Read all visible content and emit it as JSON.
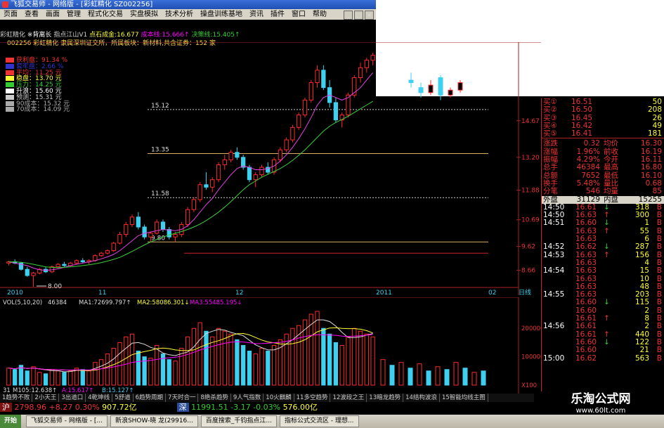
{
  "window": {
    "title": "飞狐交易师 - 网络版 - [彩虹精化 SZ002256]"
  },
  "menu": [
    "页面",
    "查看",
    "画面",
    "管理",
    "程式化交易",
    "实盘模拟",
    "技术分析",
    "操盘训练基地",
    "资讯",
    "插件",
    "窗口",
    "帮助"
  ],
  "win_buttons": [
    "_",
    "□",
    "×"
  ],
  "info": {
    "line1_parts": [
      "彩虹精化",
      "※背离长",
      "指点江山V1",
      "点石成金:16.677",
      "成本线:15.666↑",
      "决策线:15.405↑"
    ],
    "line2": "002256 彩虹精化 隶属深圳证交所，所属板块：新材料,共含证券：152 家"
  },
  "legend": [
    {
      "label": "获利盘：91.34 %",
      "color": "#e33"
    },
    {
      "label": "套牢盘：2.66 %",
      "color": "#33c"
    },
    {
      "label": "平均：11.25 元",
      "color": "#e33"
    },
    {
      "label": "稳盘：13.70 元",
      "color": "#ff3"
    },
    {
      "label": "压力：14.25 元",
      "color": "#3c3"
    },
    {
      "label": "升浪：15.60 元",
      "color": "#fff"
    },
    {
      "label": "预测：15.31 元",
      "color": "#ccc"
    },
    {
      "label": "90成本：15.32 元",
      "color": "#aaa"
    },
    {
      "label": "70成本：14.09 元",
      "color": "#aaa"
    }
  ],
  "price_annotations": [
    "15.12",
    "13.35",
    "11.58",
    "9.80",
    "8.00"
  ],
  "price_axis": [
    "14.67",
    "13.20",
    "11.88",
    "10.69",
    "9.62",
    "8.66"
  ],
  "date_axis": [
    "2010",
    "11",
    "12",
    "2011",
    "02",
    "日线"
  ],
  "vol_header": [
    "VOL(5,10,20)",
    "46384",
    "MA1:72699.797↑",
    "MA2:58086.301↓",
    "MA3:55485.195↓"
  ],
  "vol_axis": [
    "200000",
    "100000",
    "X100"
  ],
  "vol_footer": [
    "31",
    "M105:12.638↑",
    "A:15.617↑",
    "B:15.127↑"
  ],
  "quotes": {
    "bids": [
      {
        "label": "买①",
        "price": "16.51",
        "vol": "50"
      },
      {
        "label": "买②",
        "price": "16.50",
        "vol": "208"
      },
      {
        "label": "买③",
        "price": "16.45",
        "vol": "26"
      },
      {
        "label": "买④",
        "price": "16.42",
        "vol": "49"
      },
      {
        "label": "买⑤",
        "price": "16.41",
        "vol": "181"
      }
    ],
    "stats": [
      {
        "k1": "涨跌",
        "v1": "0.32",
        "k2": "均价",
        "v2": "16.30"
      },
      {
        "k1": "涨幅",
        "v1": "1.96%",
        "k2": "前收",
        "v2": "16.19"
      },
      {
        "k1": "振幅",
        "v1": "4.29%",
        "k2": "今开",
        "v2": "16.11"
      },
      {
        "k1": "总手",
        "v1": "46384",
        "k2": "最高",
        "v2": "16.80"
      },
      {
        "k1": "总额",
        "v1": "7652",
        "k2": "最低",
        "v2": "16.10"
      },
      {
        "k1": "换手",
        "v1": "5.48%",
        "k2": "量比",
        "v2": "0.68"
      },
      {
        "k1": "分笔",
        "v1": "546",
        "k2": "均量",
        "v2": "85"
      }
    ],
    "outer": {
      "k1": "外盘",
      "v1": "31129",
      "k2": "内盘",
      "v2": "15255"
    }
  },
  "ticks": [
    {
      "t": "14:50",
      "p": "16.61",
      "a": "↓",
      "v": "318",
      "s": "B"
    },
    {
      "t": "14:50",
      "p": "16.63",
      "a": "↑",
      "v": "300",
      "s": "B"
    },
    {
      "t": "14:51",
      "p": "16.60",
      "a": "↓",
      "v": "1",
      "s": "B"
    },
    {
      "t": "",
      "p": "16.63",
      "a": "↑",
      "v": "55",
      "s": "B"
    },
    {
      "t": "",
      "p": "16.63",
      "a": "",
      "v": "6",
      "s": "B"
    },
    {
      "t": "14:52",
      "p": "16.62",
      "a": "↓",
      "v": "287",
      "s": "B"
    },
    {
      "t": "14:53",
      "p": "16.63",
      "a": "↑",
      "v": "156",
      "s": "B"
    },
    {
      "t": "",
      "p": "16.63",
      "a": "",
      "v": "4",
      "s": "B"
    },
    {
      "t": "14:54",
      "p": "16.63",
      "a": "",
      "v": "15",
      "s": "B"
    },
    {
      "t": "",
      "p": "16.63",
      "a": "",
      "v": "10",
      "s": "B"
    },
    {
      "t": "",
      "p": "16.63",
      "a": "",
      "v": "48",
      "s": "B"
    },
    {
      "t": "14:55",
      "p": "16.63",
      "a": "",
      "v": "203",
      "s": "B"
    },
    {
      "t": "",
      "p": "16.60",
      "a": "↓",
      "v": "115",
      "s": "B"
    },
    {
      "t": "",
      "p": "16.60",
      "a": "",
      "v": "2",
      "s": "B"
    },
    {
      "t": "",
      "p": "16.61",
      "a": "↑",
      "v": "8",
      "s": "B"
    },
    {
      "t": "14:56",
      "p": "16.61",
      "a": "",
      "v": "2",
      "s": "B"
    },
    {
      "t": "",
      "p": "16.61",
      "a": "↑",
      "v": "440",
      "s": "B"
    },
    {
      "t": "",
      "p": "16.60",
      "a": "↓",
      "v": "122",
      "s": "B"
    },
    {
      "t": "",
      "p": "16.60",
      "a": "",
      "v": "21",
      "s": "B"
    },
    {
      "t": "15:00",
      "p": "16.62",
      "a": "",
      "v": "563",
      "s": "B"
    }
  ],
  "tabs": [
    "1趋势不败",
    "2小天王",
    "3出道口",
    "4乾坤线",
    "5舒道",
    "6趋势周期",
    "7天时合一",
    "8绝杀趋势",
    "9人气指数",
    "10火麒麟",
    "11多空趋势",
    "12波段之王",
    "13暗龙趋势",
    "14结构波浪",
    "15智能均线主图"
  ],
  "status": {
    "sh_label": "沪",
    "sh": "2798.96",
    "sh_chg": "+8.27",
    "sh_pct": "0.30%",
    "sh_amt": "907.72亿",
    "sz_label": "深",
    "sz": "11991.51",
    "sz_chg": "-3.17",
    "sz_pct": "-0.03%",
    "sz_amt": "576.00亿"
  },
  "taskbar": {
    "start": "开始",
    "items": [
      "飞狐交易师 - 网络版 - [...",
      "新浪SHOW-晓 龙(29916...",
      "百度搜索_千钧指点江...",
      "指标公式交流区 - 理想..."
    ]
  },
  "watermark": {
    "cn": "乐淘公式网",
    "url": "www.60lt.com"
  },
  "chart_data": {
    "type": "candlestick",
    "candles": [
      [
        8.95,
        9.05,
        8.85,
        9.0
      ],
      [
        9.0,
        9.1,
        8.9,
        8.95
      ],
      [
        8.95,
        9.0,
        8.65,
        8.7
      ],
      [
        8.7,
        8.8,
        8.4,
        8.45
      ],
      [
        8.45,
        8.6,
        8.0,
        8.55
      ],
      [
        8.55,
        8.75,
        8.5,
        8.7
      ],
      [
        8.7,
        8.8,
        8.55,
        8.6
      ],
      [
        8.6,
        8.85,
        8.55,
        8.8
      ],
      [
        8.8,
        8.95,
        8.75,
        8.9
      ],
      [
        8.9,
        9.0,
        8.8,
        8.85
      ],
      [
        8.85,
        9.0,
        8.8,
        8.95
      ],
      [
        8.95,
        9.1,
        8.9,
        9.05
      ],
      [
        9.05,
        9.15,
        8.95,
        9.0
      ],
      [
        9.0,
        9.1,
        8.9,
        9.05
      ],
      [
        9.05,
        9.3,
        9.0,
        9.25
      ],
      [
        9.25,
        9.4,
        9.2,
        9.35
      ],
      [
        9.35,
        9.5,
        9.3,
        9.45
      ],
      [
        9.45,
        9.8,
        9.4,
        9.75
      ],
      [
        9.75,
        10.2,
        9.7,
        10.1
      ],
      [
        10.1,
        10.6,
        10.0,
        10.5
      ],
      [
        10.5,
        10.9,
        10.4,
        10.8
      ],
      [
        10.8,
        11.0,
        10.3,
        10.4
      ],
      [
        10.4,
        10.5,
        9.9,
        10.0
      ],
      [
        10.0,
        10.2,
        9.8,
        10.15
      ],
      [
        10.15,
        10.7,
        10.1,
        10.6
      ],
      [
        10.6,
        10.7,
        10.2,
        10.3
      ],
      [
        10.3,
        10.4,
        9.9,
        10.0
      ],
      [
        10.0,
        10.2,
        9.8,
        10.1
      ],
      [
        10.1,
        10.6,
        10.0,
        10.5
      ],
      [
        10.5,
        11.2,
        10.4,
        11.1
      ],
      [
        11.1,
        11.6,
        11.0,
        11.5
      ],
      [
        11.5,
        12.2,
        11.4,
        12.1
      ],
      [
        12.1,
        12.6,
        11.9,
        12.0
      ],
      [
        12.0,
        12.4,
        11.8,
        12.3
      ],
      [
        12.3,
        13.0,
        12.2,
        12.9
      ],
      [
        12.9,
        13.3,
        12.7,
        13.1
      ],
      [
        13.1,
        13.5,
        13.0,
        13.4
      ],
      [
        13.4,
        13.6,
        13.1,
        13.2
      ],
      [
        13.2,
        13.3,
        12.7,
        12.8
      ],
      [
        12.8,
        12.9,
        12.2,
        12.3
      ],
      [
        12.3,
        12.6,
        12.0,
        12.5
      ],
      [
        12.5,
        12.9,
        12.4,
        12.8
      ],
      [
        12.8,
        13.0,
        12.5,
        12.6
      ],
      [
        12.6,
        13.2,
        12.5,
        13.1
      ],
      [
        13.1,
        13.6,
        13.0,
        13.5
      ],
      [
        13.5,
        14.0,
        13.4,
        13.9
      ],
      [
        13.9,
        14.5,
        13.8,
        14.4
      ],
      [
        14.4,
        15.0,
        14.3,
        14.9
      ],
      [
        14.9,
        15.6,
        14.8,
        15.5
      ],
      [
        15.5,
        16.3,
        15.4,
        16.2
      ],
      [
        16.2,
        16.9,
        16.0,
        16.7
      ],
      [
        16.7,
        16.9,
        15.9,
        16.0
      ],
      [
        16.0,
        16.3,
        15.2,
        15.4
      ],
      [
        15.4,
        15.6,
        14.6,
        14.7
      ],
      [
        14.7,
        15.0,
        14.4,
        14.9
      ],
      [
        14.9,
        15.8,
        14.8,
        15.7
      ],
      [
        15.7,
        16.5,
        15.6,
        16.4
      ],
      [
        16.4,
        17.0,
        16.2,
        16.8
      ],
      [
        16.8,
        17.2,
        16.6,
        17.1
      ],
      [
        17.1,
        17.4,
        16.9,
        17.3
      ]
    ],
    "ma": [
      [
        9.0,
        8.95,
        8.9,
        8.85,
        8.75,
        8.68,
        8.66,
        8.68,
        8.72,
        8.78,
        8.85,
        8.9,
        8.95,
        9.0,
        9.05,
        9.12,
        9.2,
        9.3,
        9.45,
        9.65,
        9.85,
        10.05,
        10.15,
        10.2,
        10.25,
        10.3,
        10.28,
        10.25,
        10.3,
        10.45,
        10.7,
        11.0,
        11.3,
        11.55,
        11.9,
        12.2,
        12.5,
        12.75,
        12.85,
        12.8,
        12.7,
        12.7,
        12.75,
        12.85,
        13.05,
        13.3,
        13.6,
        13.95,
        14.35,
        14.8,
        15.3,
        15.6,
        15.7,
        15.6,
        15.5,
        15.6,
        15.8,
        16.0,
        16.3,
        16.6
      ],
      [
        9.0,
        9.0,
        8.98,
        8.95,
        8.9,
        8.85,
        8.8,
        8.78,
        8.77,
        8.78,
        8.8,
        8.82,
        8.85,
        8.88,
        8.92,
        8.97,
        9.03,
        9.1,
        9.18,
        9.3,
        9.42,
        9.55,
        9.68,
        9.8,
        9.9,
        10.0,
        10.08,
        10.15,
        10.22,
        10.3,
        10.4,
        10.52,
        10.66,
        10.82,
        11.0,
        11.2,
        11.42,
        11.66,
        11.9,
        12.1,
        12.25,
        12.4,
        12.52,
        12.63,
        12.75,
        12.9,
        13.08,
        13.28,
        13.5,
        13.75,
        14.0,
        14.25,
        14.45,
        14.6,
        14.72,
        14.85,
        15.0,
        15.15,
        15.3,
        15.45
      ]
    ],
    "volumes": [
      60,
      55,
      70,
      50,
      65,
      45,
      40,
      55,
      50,
      45,
      50,
      60,
      55,
      50,
      80,
      90,
      110,
      130,
      150,
      170,
      180,
      120,
      100,
      95,
      140,
      110,
      90,
      85,
      130,
      170,
      200,
      220,
      190,
      170,
      200,
      190,
      180,
      160,
      140,
      120,
      110,
      130,
      120,
      140,
      160,
      180,
      200,
      210,
      230,
      250,
      260,
      200,
      180,
      150,
      140,
      170,
      200,
      190,
      180,
      170
    ],
    "ylim": [
      8.0,
      17.6
    ]
  }
}
